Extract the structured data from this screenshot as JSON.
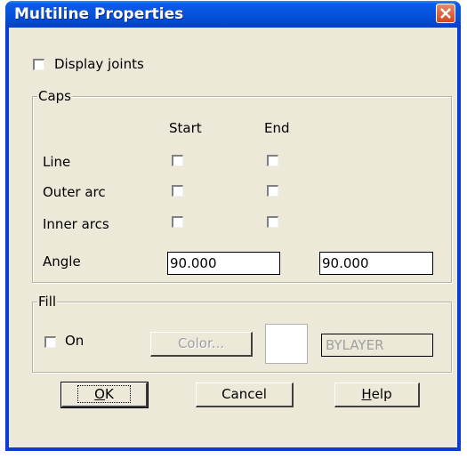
{
  "window": {
    "title": "Multiline Properties"
  },
  "display_joints": {
    "label": "Display joints",
    "checked": false
  },
  "caps": {
    "group_label": "Caps",
    "col_start": "Start",
    "col_end": "End",
    "rows": [
      {
        "label": "Line",
        "start": false,
        "end": false
      },
      {
        "label": "Outer arc",
        "start": false,
        "end": false
      },
      {
        "label": "Inner arcs",
        "start": false,
        "end": false
      }
    ],
    "angle_label": "Angle",
    "angle_start": "90.000",
    "angle_end": "90.000"
  },
  "fill": {
    "group_label": "Fill",
    "on_label": "On",
    "on_checked": false,
    "color_button": "Color...",
    "layer_value": "BYLAYER"
  },
  "buttons": {
    "ok": "OK",
    "cancel": "Cancel",
    "help": "Help"
  }
}
